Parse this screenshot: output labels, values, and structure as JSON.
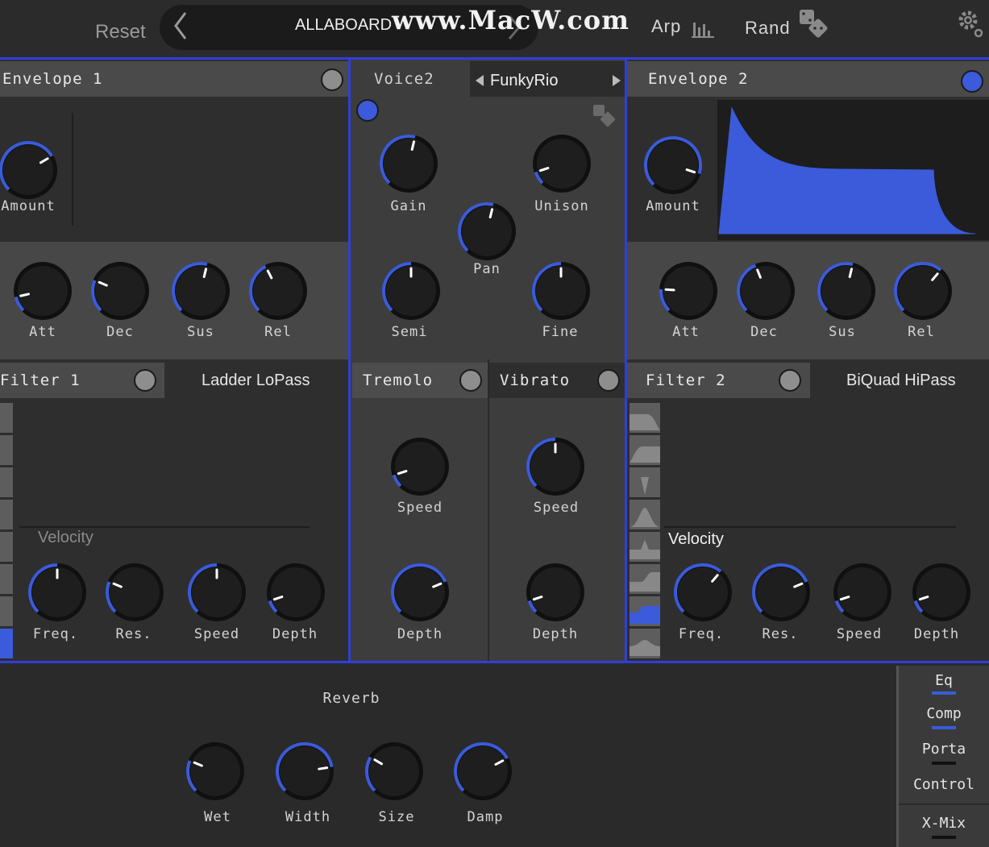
{
  "topbar": {
    "reset_label": "Reset",
    "preset_name": "ALLABOARD",
    "watermark": "www.MacW.com",
    "arp_label": "Arp",
    "rand_label": "Rand",
    "settings_icon": "gear-icon"
  },
  "envelope1": {
    "title": "Envelope  1",
    "enabled": false,
    "amount": {
      "label": "Amount",
      "value": 0.72
    },
    "att": {
      "label": "Att",
      "value": 0.12
    },
    "dec": {
      "label": "Dec",
      "value": 0.25
    },
    "sus": {
      "label": "Sus",
      "value": 0.55
    },
    "rel": {
      "label": "Rel",
      "value": 0.4
    }
  },
  "voice": {
    "tab_label": "Voice2",
    "preset_label": "FunkyRio",
    "enabled": true,
    "gain": {
      "label": "Gain",
      "value": 0.55
    },
    "unison": {
      "label": "Unison",
      "value": 0.1
    },
    "pan": {
      "label": "Pan",
      "value": 0.55
    },
    "semi": {
      "label": "Semi",
      "value": 0.5
    },
    "fine": {
      "label": "Fine",
      "value": 0.5
    }
  },
  "envelope2": {
    "title": "Envelope  2",
    "enabled": true,
    "amount": {
      "label": "Amount",
      "value": 0.9
    },
    "att": {
      "label": "Att",
      "value": 0.18
    },
    "dec": {
      "label": "Dec",
      "value": 0.42
    },
    "sus": {
      "label": "Sus",
      "value": 0.55
    },
    "rel": {
      "label": "Rel",
      "value": 0.65
    }
  },
  "filter1": {
    "title": "Filter  1",
    "type": "Ladder LoPass",
    "enabled": false,
    "velocity_label": "Velocity",
    "freq": {
      "label": "Freq.",
      "value": 0.5
    },
    "res": {
      "label": "Res.",
      "value": 0.25
    },
    "speed": {
      "label": "Speed",
      "value": 0.5
    },
    "depth": {
      "label": "Depth",
      "value": 0.1
    }
  },
  "tremolo": {
    "title": "Tremolo",
    "enabled": false,
    "speed": {
      "label": "Speed",
      "value": 0.1
    },
    "depth": {
      "label": "Depth",
      "value": 0.75
    }
  },
  "vibrato": {
    "title": "Vibrato",
    "enabled": false,
    "speed": {
      "label": "Speed",
      "value": 0.5
    },
    "depth": {
      "label": "Depth",
      "value": 0.1
    }
  },
  "filter2": {
    "title": "Filter  2",
    "type": "BiQuad HiPass",
    "enabled": false,
    "velocity_label": "Velocity",
    "freq": {
      "label": "Freq.",
      "value": 0.65
    },
    "res": {
      "label": "Res.",
      "value": 0.75
    },
    "speed": {
      "label": "Speed",
      "value": 0.1
    },
    "depth": {
      "label": "Depth",
      "value": 0.1
    }
  },
  "reverb": {
    "title": "Reverb",
    "wet": {
      "label": "Wet",
      "value": 0.25
    },
    "width": {
      "label": "Width",
      "value": 0.8
    },
    "size": {
      "label": "Size",
      "value": 0.28
    },
    "damp": {
      "label": "Damp",
      "value": 0.73
    }
  },
  "sidebar": {
    "eq": "Eq",
    "comp": "Comp",
    "porta": "Porta",
    "control": "Control",
    "xmix": "X-Mix"
  },
  "colors": {
    "accent": "#3b5bdb",
    "panel": "#3c3c3c",
    "background": "#2a2a2a",
    "knob": "#1e1e1e",
    "toggle_off": "#8e8e8e"
  }
}
